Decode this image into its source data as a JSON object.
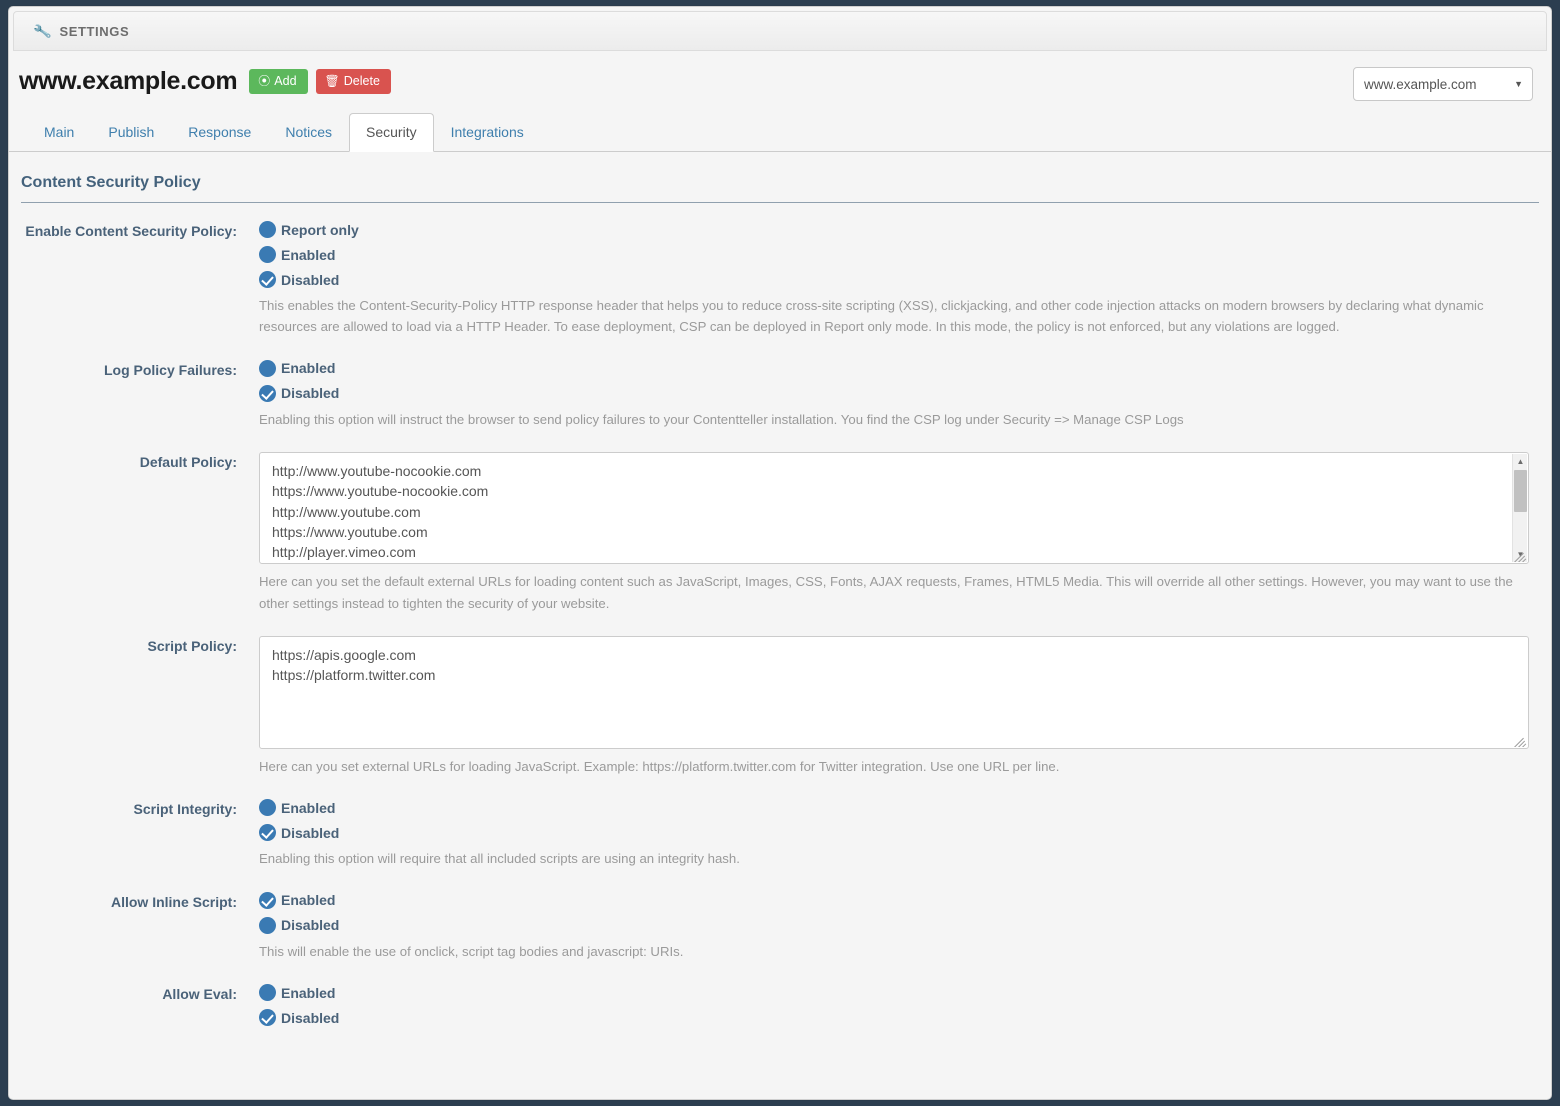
{
  "header": {
    "settings_label": "SETTINGS",
    "wrench_icon": "wrench-icon",
    "site_title": "www.example.com",
    "add_label": "Add",
    "delete_label": "Delete",
    "add_icon": "plus-circle-icon",
    "delete_icon": "trash-icon",
    "site_select_value": "www.example.com",
    "caret_icon": "chevron-down-icon"
  },
  "tabs": [
    {
      "label": "Main",
      "active": false
    },
    {
      "label": "Publish",
      "active": false
    },
    {
      "label": "Response",
      "active": false
    },
    {
      "label": "Notices",
      "active": false
    },
    {
      "label": "Security",
      "active": true
    },
    {
      "label": "Integrations",
      "active": false
    }
  ],
  "section": {
    "title": "Content Security Policy"
  },
  "rows": {
    "enable_csp": {
      "label": "Enable Content Security Policy:",
      "options": [
        {
          "label": "Report only",
          "selected": false
        },
        {
          "label": "Enabled",
          "selected": false
        },
        {
          "label": "Disabled",
          "selected": true
        }
      ],
      "help": "This enables the Content-Security-Policy HTTP response header that helps you to reduce cross-site scripting (XSS), clickjacking, and other code injection attacks on modern browsers by declaring what dynamic resources are allowed to load via a HTTP Header. To ease deployment, CSP can be deployed in Report only mode. In this mode, the policy is not enforced, but any violations are logged."
    },
    "log_policy_failures": {
      "label": "Log Policy Failures:",
      "options": [
        {
          "label": "Enabled",
          "selected": false
        },
        {
          "label": "Disabled",
          "selected": true
        }
      ],
      "help": "Enabling this option will instruct the browser to send policy failures to your Contentteller installation. You find the CSP log under Security => Manage CSP Logs"
    },
    "default_policy": {
      "label": "Default Policy:",
      "value": "http://www.youtube-nocookie.com\nhttps://www.youtube-nocookie.com\nhttp://www.youtube.com\nhttps://www.youtube.com\nhttp://player.vimeo.com\nhttps://player.vimeo.com",
      "help": "Here can you set the default external URLs for loading content such as JavaScript, Images, CSS, Fonts, AJAX requests, Frames, HTML5 Media. This will override all other settings. However, you may want to use the other settings instead to tighten the security of your website."
    },
    "script_policy": {
      "label": "Script Policy:",
      "value": "https://apis.google.com\nhttps://platform.twitter.com",
      "help": "Here can you set external URLs for loading JavaScript. Example: https://platform.twitter.com for Twitter integration. Use one URL per line."
    },
    "script_integrity": {
      "label": "Script Integrity:",
      "options": [
        {
          "label": "Enabled",
          "selected": false
        },
        {
          "label": "Disabled",
          "selected": true
        }
      ],
      "help": "Enabling this option will require that all included scripts are using an integrity hash."
    },
    "allow_inline_script": {
      "label": "Allow Inline Script:",
      "options": [
        {
          "label": "Enabled",
          "selected": true
        },
        {
          "label": "Disabled",
          "selected": false
        }
      ],
      "help": "This will enable the use of onclick, script tag bodies and javascript: URIs."
    },
    "allow_eval": {
      "label": "Allow Eval:",
      "options": [
        {
          "label": "Enabled",
          "selected": false
        },
        {
          "label": "Disabled",
          "selected": true
        }
      ]
    }
  },
  "colors": {
    "accent_blue": "#3a7ab3",
    "label_blue": "#4a6279",
    "tab_link": "#3f7fad",
    "add_green": "#5cb85c",
    "delete_red": "#d9534f",
    "help_gray": "#9a9a9a",
    "page_bg": "#f5f5f5",
    "frame_bg": "#2c3e50"
  }
}
